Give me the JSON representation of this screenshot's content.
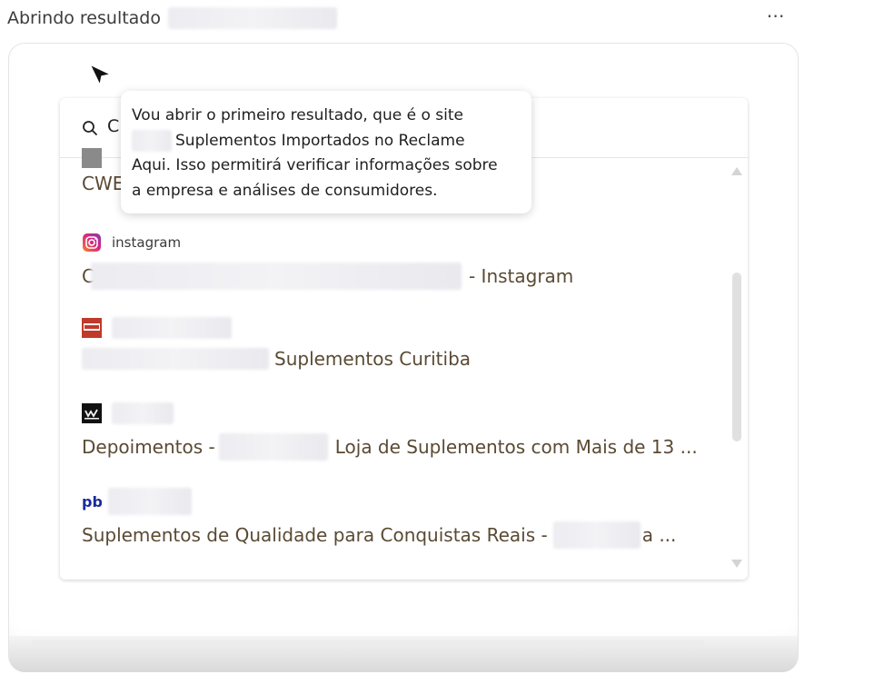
{
  "header": {
    "title_prefix": "Abrindo resultado",
    "more_label": "⋯"
  },
  "search": {
    "visible_text": "C"
  },
  "tooltip": {
    "line1": "Vou abrir o primeiro resultado, que é o site",
    "line2": "Suplementos Importados no Reclame",
    "line3": "Aqui. Isso permitirá verificar informações sobre",
    "line4": "a empresa e análises de consumidores."
  },
  "results": [
    {
      "source": "",
      "title_suffix": "",
      "title_prefix": "CWE",
      "icon": "cwb-favicon-icon"
    },
    {
      "source": "instagram",
      "title_prefix": "C",
      "title_suffix": "- Instagram",
      "icon": "instagram-icon"
    },
    {
      "source": "",
      "title_prefix": "",
      "title_suffix": "Suplementos Curitiba",
      "icon": "cwb-favicon-icon"
    },
    {
      "source": "",
      "title_prefix": "Depoimentos -",
      "title_suffix": "Loja de Suplementos com Mais de 13 ...",
      "icon": "cw-favicon-icon"
    },
    {
      "source": "",
      "title_prefix": "Suplementos de Qualidade para Conquistas Reais -",
      "title_suffix": "a ...",
      "icon": "pb-favicon-icon"
    }
  ],
  "colors": {
    "title_text": "#5a4a33",
    "instagram_gradient": [
      "#f58529",
      "#dd2a7b",
      "#8134af"
    ],
    "pb_blue": "#1a2b9c"
  }
}
